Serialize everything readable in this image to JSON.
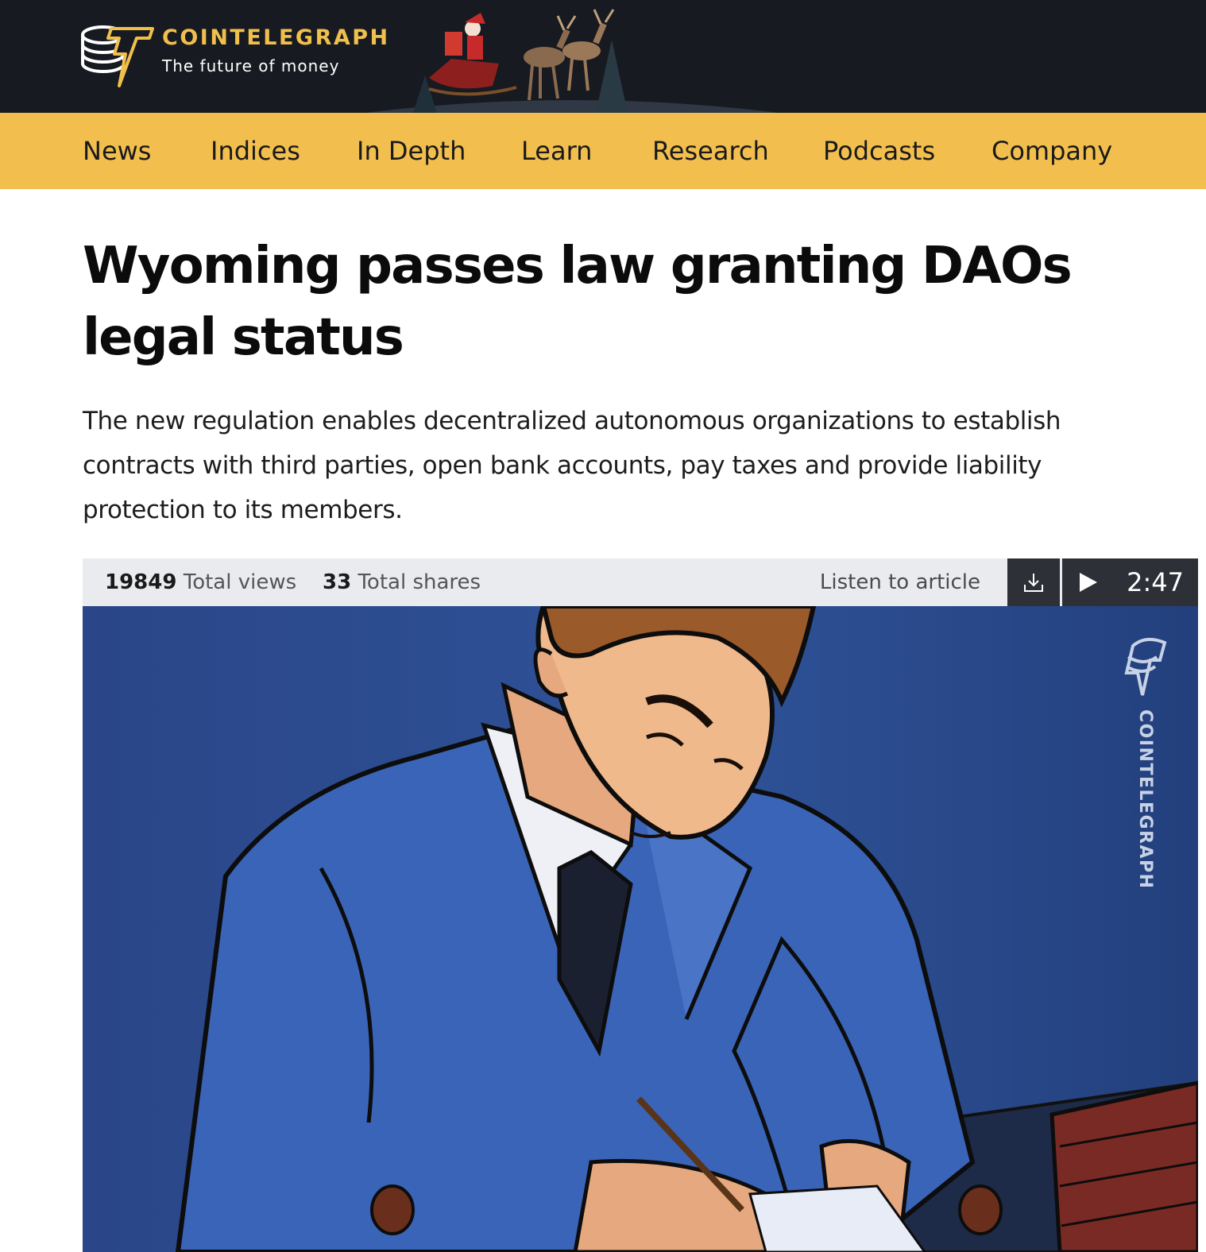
{
  "header": {
    "brand_name": "COINTELEGRAPH",
    "tagline": "The future of money",
    "logo_icon": "cointelegraph-logo-icon",
    "colors": {
      "background": "#171a20",
      "brand": "#f0bf4c"
    }
  },
  "nav": {
    "items": [
      {
        "label": "News"
      },
      {
        "label": "Indices"
      },
      {
        "label": "In Depth"
      },
      {
        "label": "Learn"
      },
      {
        "label": "Research"
      },
      {
        "label": "Podcasts"
      },
      {
        "label": "Company"
      }
    ],
    "background": "#f2bf4f"
  },
  "article": {
    "title": "Wyoming passes law granting DAOs legal status",
    "lead": "The new regulation enables decentralized autonomous organizations to establish contracts with third parties, open bank accounts, pay taxes and provide liability protection to its members.",
    "stats": {
      "views_value": "19849",
      "views_label": "Total views",
      "shares_value": "33",
      "shares_label": "Total shares"
    },
    "audio": {
      "listen_label": "Listen to article",
      "duration": "2:47",
      "download_icon": "download-icon",
      "play_icon": "play-icon"
    },
    "hero_image": {
      "watermark": "COINTELEGRAPH"
    }
  }
}
